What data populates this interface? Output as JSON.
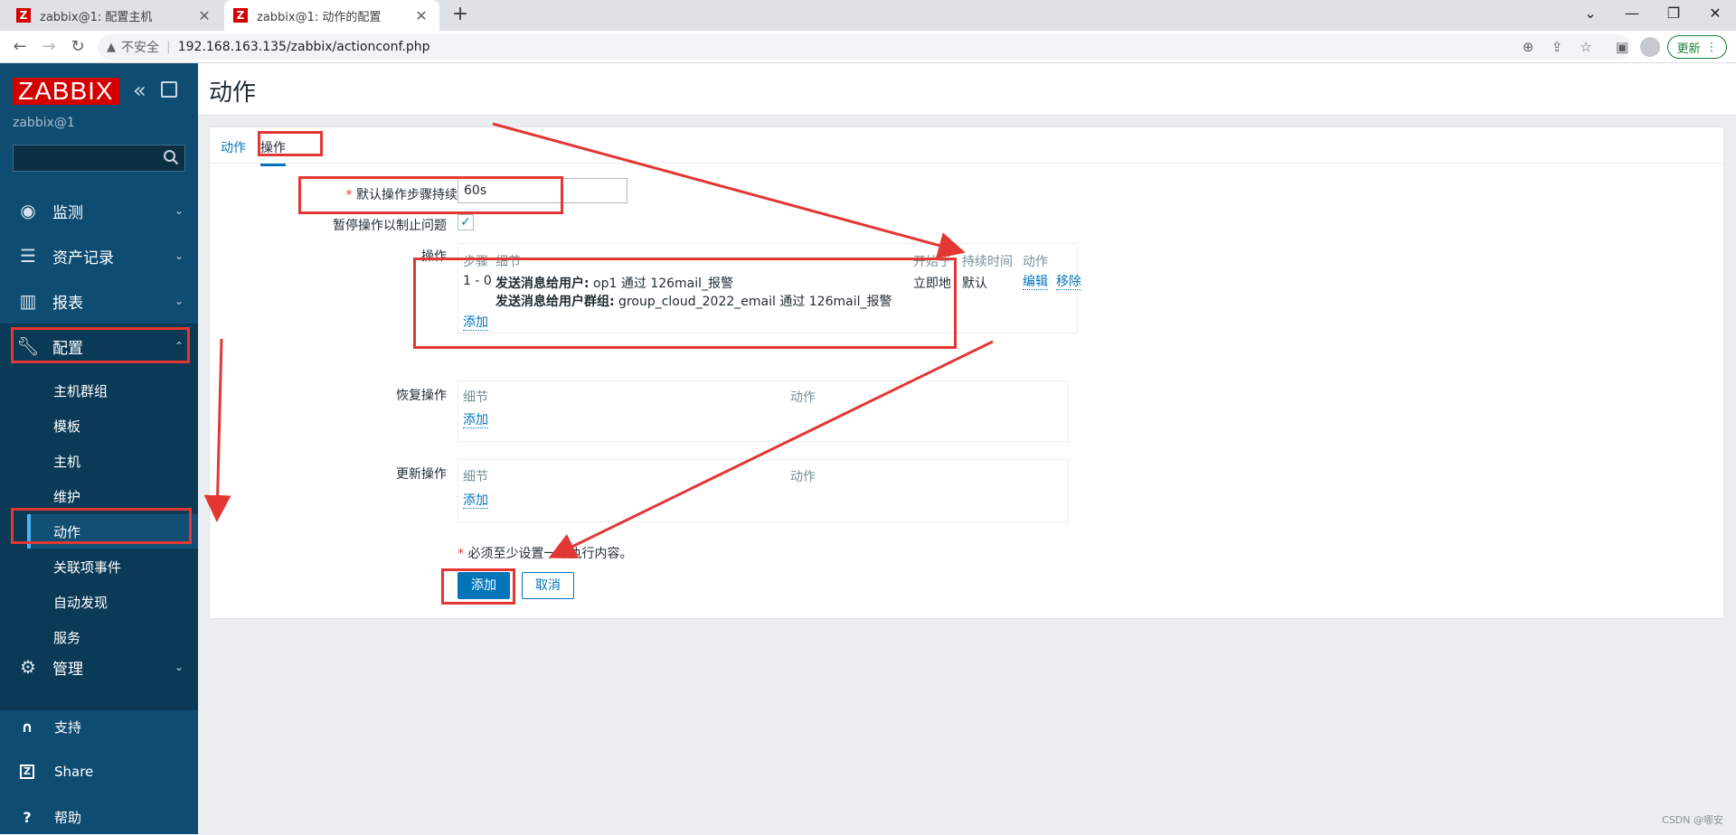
{
  "browser": {
    "tabs": [
      {
        "title": "zabbix@1: 配置主机",
        "favicon": "Z",
        "active": false
      },
      {
        "title": "zabbix@1: 动作的配置",
        "favicon": "Z",
        "active": true
      }
    ],
    "insecure_label": "不安全",
    "url": "192.168.163.135/zabbix/actionconf.php",
    "update_label": "更新"
  },
  "sidebar": {
    "logo": "ZABBIX",
    "server": "zabbix@1",
    "menu": [
      {
        "label": "监测",
        "icon": "eye-icon"
      },
      {
        "label": "资产记录",
        "icon": "list-icon"
      },
      {
        "label": "报表",
        "icon": "chart-icon"
      },
      {
        "label": "配置",
        "icon": "wrench-icon",
        "expanded": true
      },
      {
        "label": "管理",
        "icon": "gear-icon"
      }
    ],
    "submenu": [
      "主机群组",
      "模板",
      "主机",
      "维护",
      "动作",
      "关联项事件",
      "自动发现",
      "服务"
    ],
    "active_submenu": "动作",
    "bottom": [
      {
        "label": "支持",
        "icon": "headset-icon"
      },
      {
        "label": "Share",
        "icon": "zabbix-share-icon"
      },
      {
        "label": "帮助",
        "icon": "help-icon"
      }
    ]
  },
  "page": {
    "title": "动作",
    "tabs": [
      "动作",
      "操作"
    ],
    "selected_tab": "操作"
  },
  "form": {
    "step_duration_label": "默认操作步骤持续时间",
    "step_duration_value": "60s",
    "pause_label": "暂停操作以制止问题",
    "pause_checked": true,
    "operations_label": "操作",
    "operations_headers": [
      "步骤",
      "细节",
      "开始于",
      "持续时间",
      "动作"
    ],
    "operation_row": {
      "step": "1 - 0",
      "detail1_bold": "发送消息给用户:",
      "detail1_rest": " op1 通过 126mail_报警",
      "detail2_bold": "发送消息给用户群组:",
      "detail2_rest": " group_cloud_2022_email 通过 126mail_报警",
      "start": "立即地",
      "duration": "默认",
      "edit": "编辑",
      "remove": "移除"
    },
    "add_link": "添加",
    "recovery_label": "恢复操作",
    "update_label": "更新操作",
    "sub_headers": [
      "细节",
      "动作"
    ],
    "required_note": "必须至少设置一个执行内容。",
    "add_button": "添加",
    "cancel_button": "取消"
  },
  "watermark": "CSDN @哪安",
  "colors": {
    "sidebar": "#0f4c72",
    "accent": "#0275b8",
    "brand_red": "#d40000",
    "annotation": "#e33734"
  }
}
